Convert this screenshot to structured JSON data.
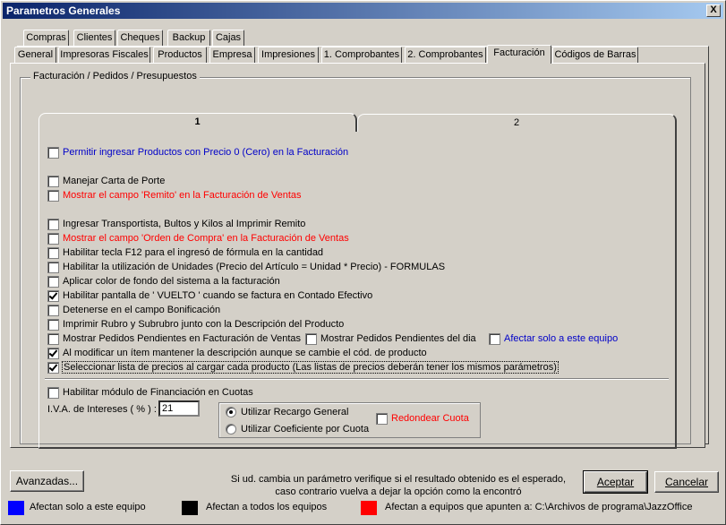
{
  "window": {
    "title": "Parametros Generales",
    "close_label": "X"
  },
  "tabs_row1": [
    "Compras",
    "Clientes",
    "Cheques",
    "Backup",
    "Cajas"
  ],
  "tabs_row2": [
    "General",
    "Impresoras Fiscales",
    "Productos",
    "Empresa",
    "Impresiones",
    "1. Comprobantes",
    "2. Comprobantes",
    "Facturación",
    "Códigos de Barras"
  ],
  "active_tab": "Facturación",
  "group_title": "Facturación / Pedidos / Presupuestos",
  "subtabs": [
    "1",
    "2"
  ],
  "options": [
    {
      "label": "Permitir ingresar Productos con Precio 0 (Cero) en la Facturación",
      "checked": false,
      "color": "#0000c8"
    },
    {
      "label": "Manejar Carta de Porte",
      "checked": false,
      "color": "#000000"
    },
    {
      "label": "Mostrar el campo 'Remito' en la Facturación de Ventas",
      "checked": false,
      "color": "#ff0000"
    },
    {
      "label": "Ingresar Transportista, Bultos y Kilos al Imprimir Remito",
      "checked": false,
      "color": "#000000"
    },
    {
      "label": "Mostrar el campo 'Orden de Compra' en la Facturación de Ventas",
      "checked": false,
      "color": "#ff0000"
    },
    {
      "label": "Habilitar tecla F12 para el ingresó de fórmula en la cantidad",
      "checked": false,
      "color": "#000000"
    },
    {
      "label": "Habilitar la utilización de Unidades (Precio del Artículo = Unidad * Precio) - FORMULAS",
      "checked": false,
      "color": "#000000"
    },
    {
      "label": "Aplicar color de fondo del sistema a la facturación",
      "checked": false,
      "color": "#000000"
    },
    {
      "label": "Habilitar pantalla de ' VUELTO ' cuando se factura en Contado Efectivo",
      "checked": true,
      "color": "#000000"
    },
    {
      "label": "Detenerse en el campo Bonificación",
      "checked": false,
      "color": "#000000"
    },
    {
      "label": "Imprimir Rubro y Subrubro junto con la Descripción del Producto",
      "checked": false,
      "color": "#000000"
    },
    {
      "label": "Mostrar Pedidos Pendientes en Facturación de Ventas",
      "checked": false,
      "color": "#000000"
    },
    {
      "label": "Mostrar Pedidos Pendientes del dia",
      "checked": false,
      "color": "#000000"
    },
    {
      "label": "Afectar solo a este equipo",
      "checked": false,
      "color": "#0000c8"
    },
    {
      "label": "Al modificar un ítem mantener la descripción aunque se cambie el cód. de producto",
      "checked": true,
      "color": "#000000"
    },
    {
      "label": "Seleccionar lista de precios al cargar cada producto (Las listas de precios deberán tener los mismos parámetros)",
      "checked": true,
      "color": "#000000"
    },
    {
      "label": "Habilitar módulo de Financiación en Cuotas",
      "checked": false,
      "color": "#000000"
    }
  ],
  "iva": {
    "label": "I.V.A. de Intereses  ( % ) :",
    "value": "21"
  },
  "radios": [
    {
      "label": "Utilizar Recargo General",
      "checked": true
    },
    {
      "label": "Utilizar Coeficiente por Cuota",
      "checked": false
    }
  ],
  "redondear": {
    "label": "Redondear Cuota",
    "checked": false,
    "color": "#ff0000"
  },
  "buttons": {
    "advanced": "Avanzadas...",
    "accept": "Aceptar",
    "cancel": "Cancelar"
  },
  "note": [
    "Si ud. cambia un parámetro verifique si el resultado obtenido es el esperado,",
    "caso contrario vuelva a dejar la opción como la encontró"
  ],
  "legend": [
    {
      "color": "#0000ff",
      "label": "Afectan solo a este equipo"
    },
    {
      "color": "#000000",
      "label": "Afectan a todos los equipos"
    },
    {
      "color": "#ff0000",
      "label": "Afectan a equipos que apunten a: C:\\Archivos de programa\\JazzOffice"
    }
  ]
}
